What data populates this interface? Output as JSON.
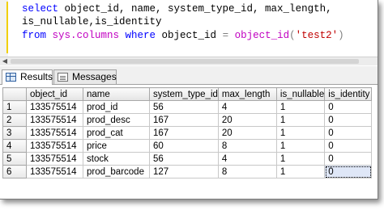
{
  "editor": {
    "line1": {
      "kw1": "select",
      "cols": " object_id, name, system_type_id, max_length,"
    },
    "line2": {
      "cols": "is_nullable,is_identity"
    },
    "line3": {
      "kw1": "from",
      "obj": " sys.columns",
      "kw2": " where",
      "col": " object_id",
      "op": " =",
      "fn": " object_id",
      "lp": "(",
      "str": "'test2'",
      "rp": ")"
    }
  },
  "tabs": [
    {
      "label": "Results",
      "icon": "grid-icon",
      "active": true
    },
    {
      "label": "Messages",
      "icon": "messages-icon",
      "active": false
    }
  ],
  "results": {
    "columns": [
      "object_id",
      "name",
      "system_type_id",
      "max_length",
      "is_nullable",
      "is_identity"
    ],
    "rows": [
      {
        "num": "1",
        "cells": [
          "133575514",
          "prod_id",
          "56",
          "4",
          "1",
          "0"
        ]
      },
      {
        "num": "2",
        "cells": [
          "133575514",
          "prod_desc",
          "167",
          "20",
          "1",
          "0"
        ]
      },
      {
        "num": "3",
        "cells": [
          "133575514",
          "prod_cat",
          "167",
          "20",
          "1",
          "0"
        ]
      },
      {
        "num": "4",
        "cells": [
          "133575514",
          "price",
          "60",
          "8",
          "1",
          "0"
        ]
      },
      {
        "num": "5",
        "cells": [
          "133575514",
          "stock",
          "56",
          "4",
          "1",
          "0"
        ]
      },
      {
        "num": "6",
        "cells": [
          "133575514",
          "prod_barcode",
          "127",
          "8",
          "1",
          "0"
        ]
      }
    ],
    "selected_cell": {
      "row": 5,
      "col": 5
    }
  },
  "colors": {
    "keyword": "#0000ff",
    "system_object": "#c100c1",
    "operator": "#808080",
    "string": "#c00000",
    "selection": "#dfe7f7"
  }
}
